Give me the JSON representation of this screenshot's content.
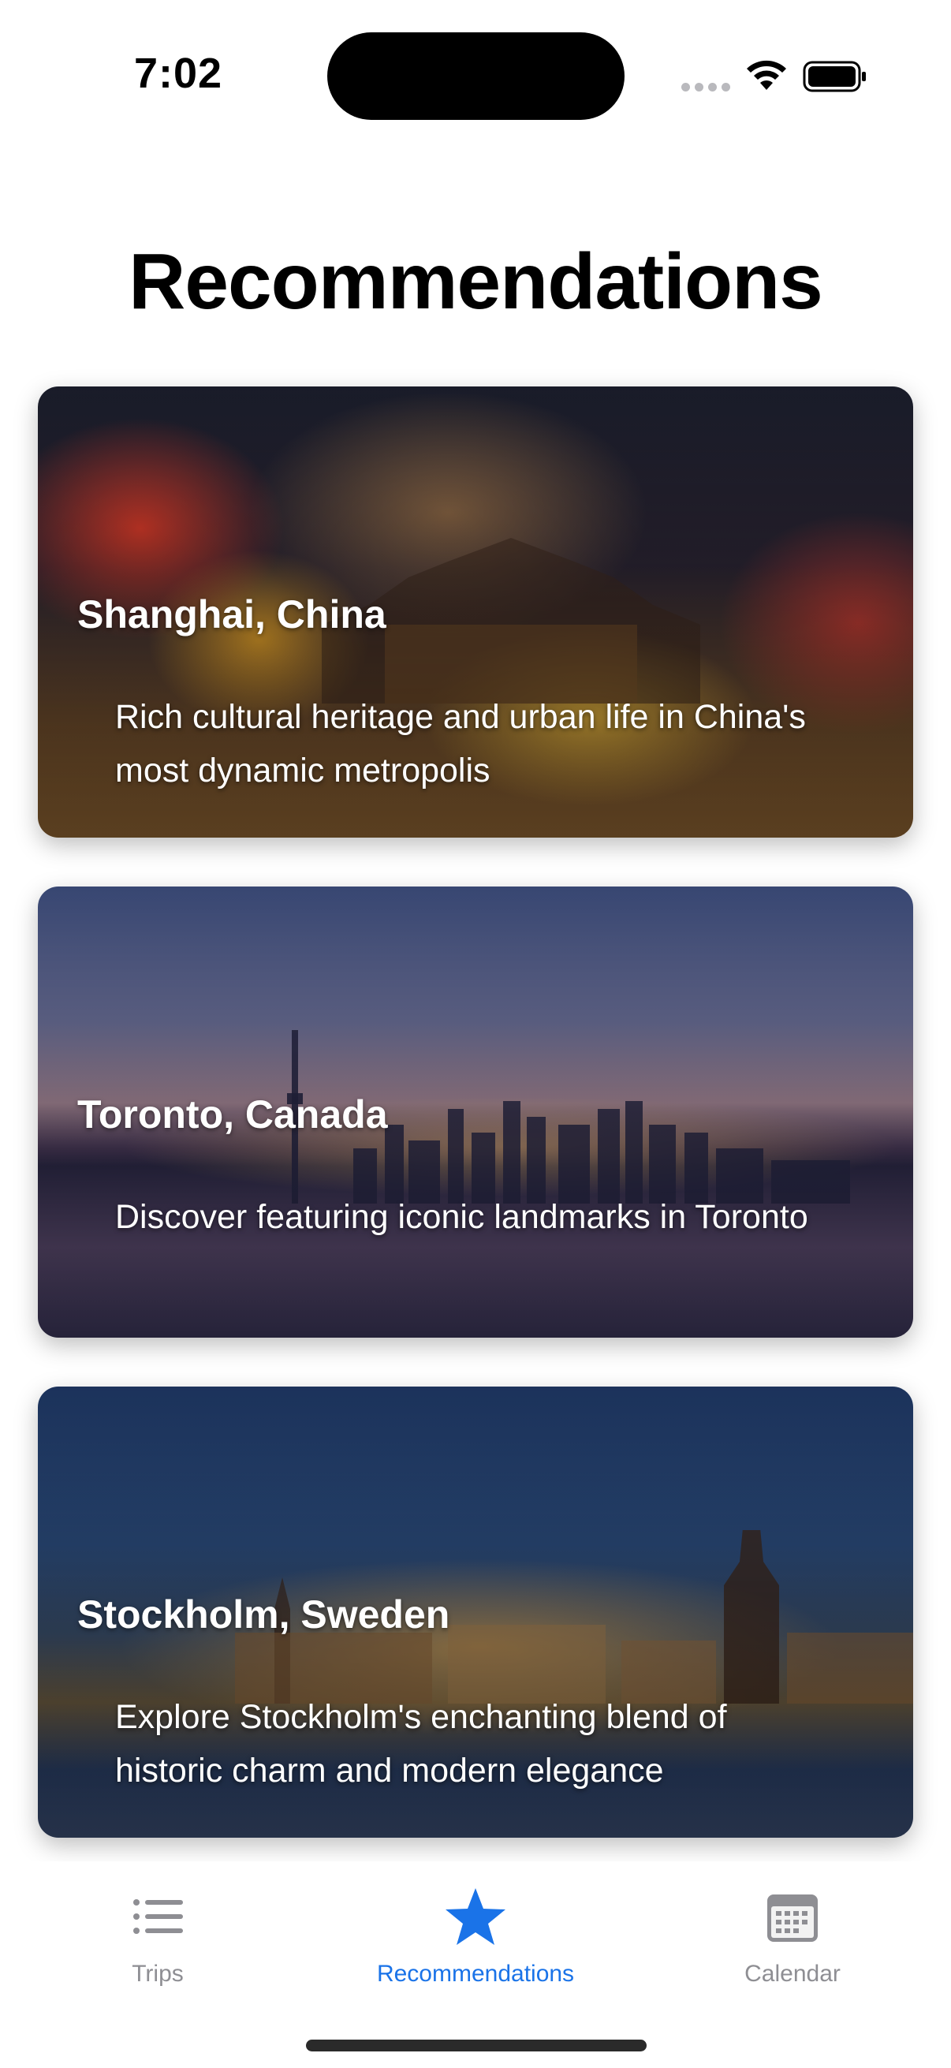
{
  "status_bar": {
    "time": "7:02"
  },
  "page": {
    "title": "Recommendations"
  },
  "recommendations": [
    {
      "title": "Shanghai, China",
      "description": "Rich cultural heritage and urban life in China's most dynamic metropolis"
    },
    {
      "title": "Toronto, Canada",
      "description": "Discover featuring iconic landmarks in Toronto"
    },
    {
      "title": "Stockholm, Sweden",
      "description": "Explore Stockholm's enchanting blend of historic charm and modern elegance"
    }
  ],
  "tab_bar": {
    "tabs": [
      {
        "label": "Trips",
        "icon": "list-icon",
        "active": false
      },
      {
        "label": "Recommendations",
        "icon": "star-icon",
        "active": true
      },
      {
        "label": "Calendar",
        "icon": "calendar-icon",
        "active": false
      }
    ],
    "accent_color": "#1a73e8",
    "inactive_color": "#8e8e93"
  }
}
